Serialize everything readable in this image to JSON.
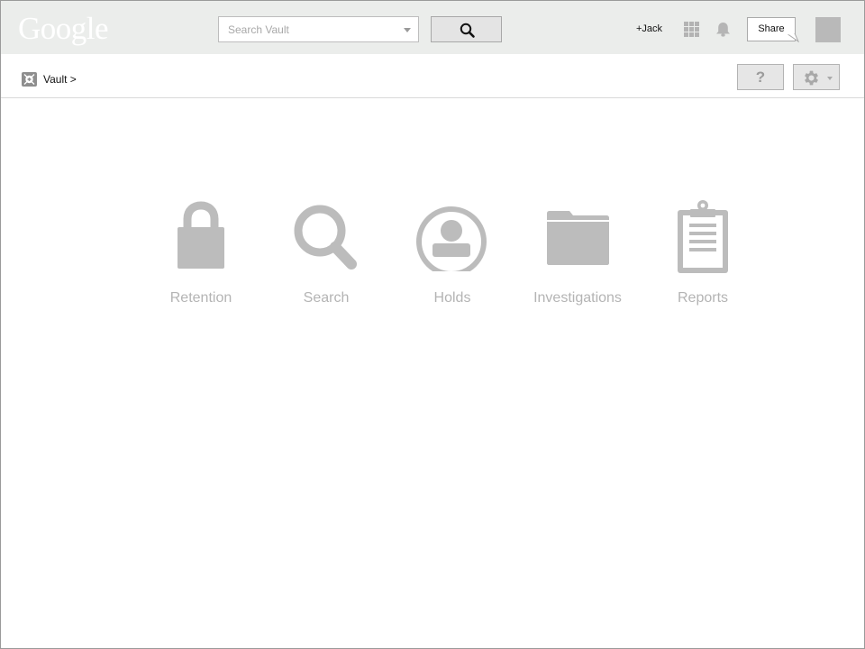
{
  "header": {
    "logo": "Google",
    "search": {
      "placeholder": "Search Vault",
      "value": ""
    },
    "plus_user": "+Jack",
    "share_label": "Share"
  },
  "breadcrumb": {
    "label": "Vault >"
  },
  "toolbar": {
    "help_label": "?"
  },
  "tiles": [
    {
      "label": "Retention",
      "icon": "lock-icon"
    },
    {
      "label": "Search",
      "icon": "magnifier-icon"
    },
    {
      "label": "Holds",
      "icon": "person-circle-icon"
    },
    {
      "label": "Investigations",
      "icon": "folder-icon"
    },
    {
      "label": "Reports",
      "icon": "clipboard-icon"
    }
  ],
  "colors": {
    "topbar_bg": "#ebedeb",
    "icon_gray": "#bcbcbc",
    "label_gray": "#b4b4b4"
  }
}
